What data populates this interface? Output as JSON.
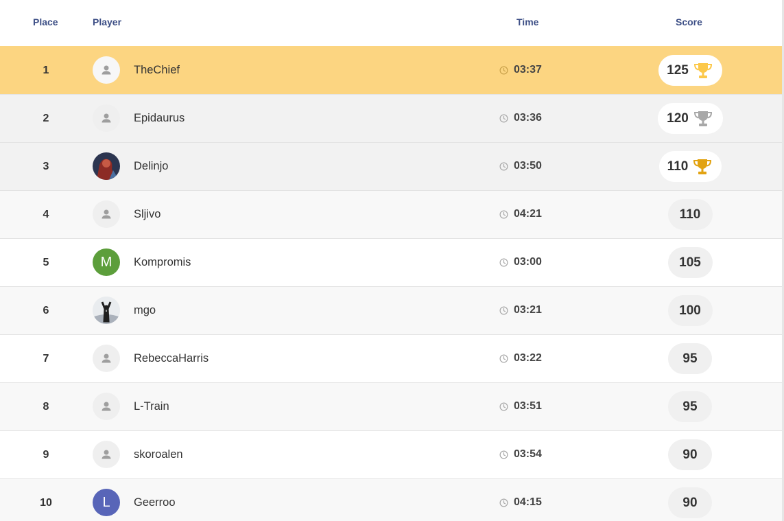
{
  "header": {
    "place": "Place",
    "player": "Player",
    "time": "Time",
    "score": "Score"
  },
  "colors": {
    "first_row": "#fcd581",
    "alt_row": "#f2f2f2",
    "light_row": "#f8f8f8",
    "white_row": "#ffffff",
    "score_pill_top": "#ffffff",
    "score_pill": "#f0f0f0",
    "trophy_gold_light": "#fcc84a",
    "trophy_silver": "#a8a8a8",
    "trophy_gold": "#e2a312",
    "avatar_m": "#5c9e3b",
    "avatar_l": "#5865b8"
  },
  "rows": [
    {
      "place": "1",
      "name": "TheChief",
      "time": "03:37",
      "score": "125",
      "trophy": "gold-light-trophy-icon",
      "avatar": "default-user-icon"
    },
    {
      "place": "2",
      "name": "Epidaurus",
      "time": "03:36",
      "score": "120",
      "trophy": "silver-trophy-icon",
      "avatar": "default-user-icon"
    },
    {
      "place": "3",
      "name": "Delinjo",
      "time": "03:50",
      "score": "110",
      "trophy": "gold-trophy-icon",
      "avatar": "photo-avatar"
    },
    {
      "place": "4",
      "name": "Sljivo",
      "time": "04:21",
      "score": "110",
      "avatar": "default-user-icon"
    },
    {
      "place": "5",
      "name": "Kompromis",
      "time": "03:00",
      "score": "105",
      "avatar": "letter-avatar",
      "letter": "M"
    },
    {
      "place": "6",
      "name": "mgo",
      "time": "03:21",
      "score": "100",
      "avatar": "photo-avatar"
    },
    {
      "place": "7",
      "name": "RebeccaHarris",
      "time": "03:22",
      "score": "95",
      "avatar": "default-user-icon"
    },
    {
      "place": "8",
      "name": "L-Train",
      "time": "03:51",
      "score": "95",
      "avatar": "default-user-icon"
    },
    {
      "place": "9",
      "name": "skoroalen",
      "time": "03:54",
      "score": "90",
      "avatar": "default-user-icon"
    },
    {
      "place": "10",
      "name": "Geerroo",
      "time": "04:15",
      "score": "90",
      "avatar": "letter-avatar",
      "letter": "L"
    }
  ]
}
